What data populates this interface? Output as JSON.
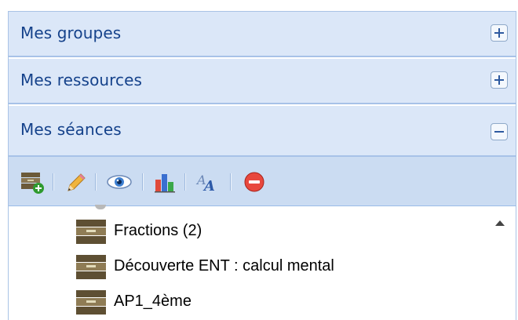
{
  "panels": [
    {
      "label": "Mes groupes",
      "toggle": "expand-icon"
    },
    {
      "label": "Mes ressources",
      "toggle": "expand-icon"
    },
    {
      "label": "Mes séances",
      "toggle": "collapse-icon"
    }
  ],
  "toolbar": {
    "buttons": [
      {
        "name": "add-session",
        "icon": "drawer-add-icon"
      },
      {
        "name": "edit",
        "icon": "pencil-icon"
      },
      {
        "name": "preview",
        "icon": "eye-icon"
      },
      {
        "name": "statistics",
        "icon": "bar-chart-icon"
      },
      {
        "name": "rename",
        "icon": "font-icon"
      },
      {
        "name": "delete",
        "icon": "delete-icon"
      }
    ]
  },
  "sessions": [
    {
      "label": "Fractions (2)",
      "icon": "drawer-icon"
    },
    {
      "label": "Découverte ENT : calcul mental",
      "icon": "drawer-icon"
    },
    {
      "label": "AP1_4ème",
      "icon": "drawer-icon"
    }
  ],
  "colors": {
    "header_bg": "#dbe7f8",
    "header_text": "#15428b",
    "toolbar_bg": "#cbdcf2",
    "border": "#a9c3e6"
  }
}
